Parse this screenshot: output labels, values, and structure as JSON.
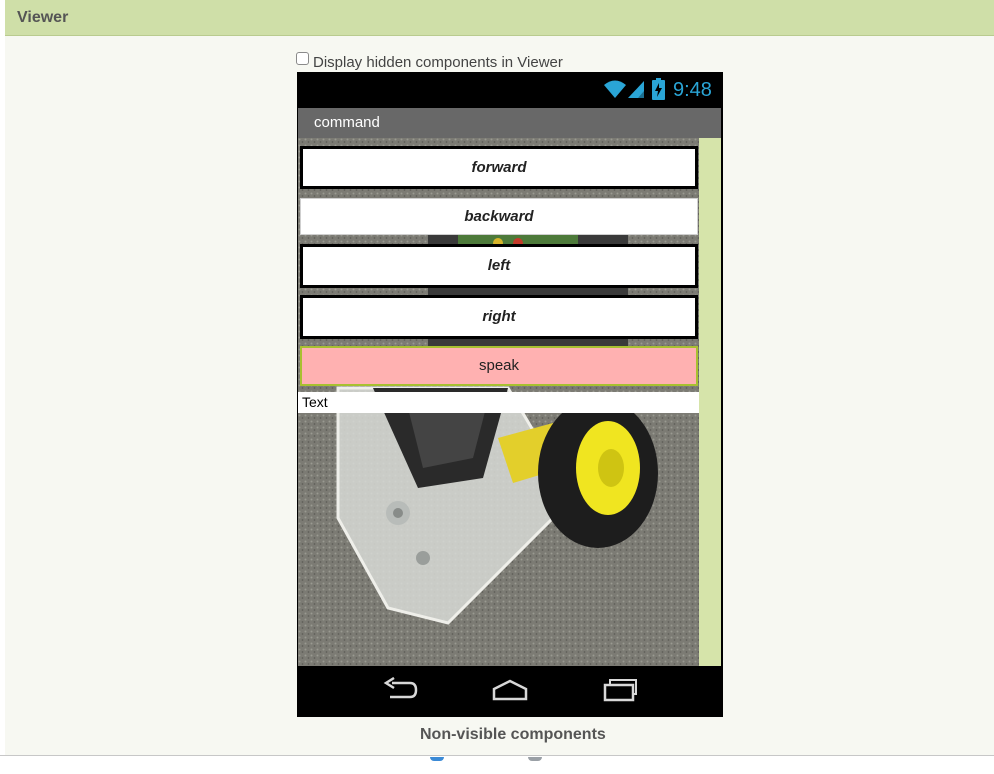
{
  "viewer": {
    "title": "Viewer",
    "display_hidden_label": "Display hidden components in Viewer",
    "display_hidden_checked": false,
    "non_visible_label": "Non-visible components"
  },
  "phone": {
    "time": "9:48",
    "status_icons": [
      "wifi-icon",
      "signal-icon",
      "battery-icon"
    ],
    "title": "command",
    "buttons": {
      "forward": "forward",
      "backward": "backward",
      "left": "left",
      "right": "right",
      "speak": "speak"
    },
    "text_label": "Text",
    "nav_icons": [
      "back-icon",
      "home-icon",
      "recents-icon"
    ],
    "colors": {
      "header_green": "#cfdfa8",
      "speak_bg": "#ffb1b1",
      "speak_border": "#a8c030",
      "clock_blue": "#2aa5d6",
      "title_bar_gray": "#686868"
    }
  }
}
